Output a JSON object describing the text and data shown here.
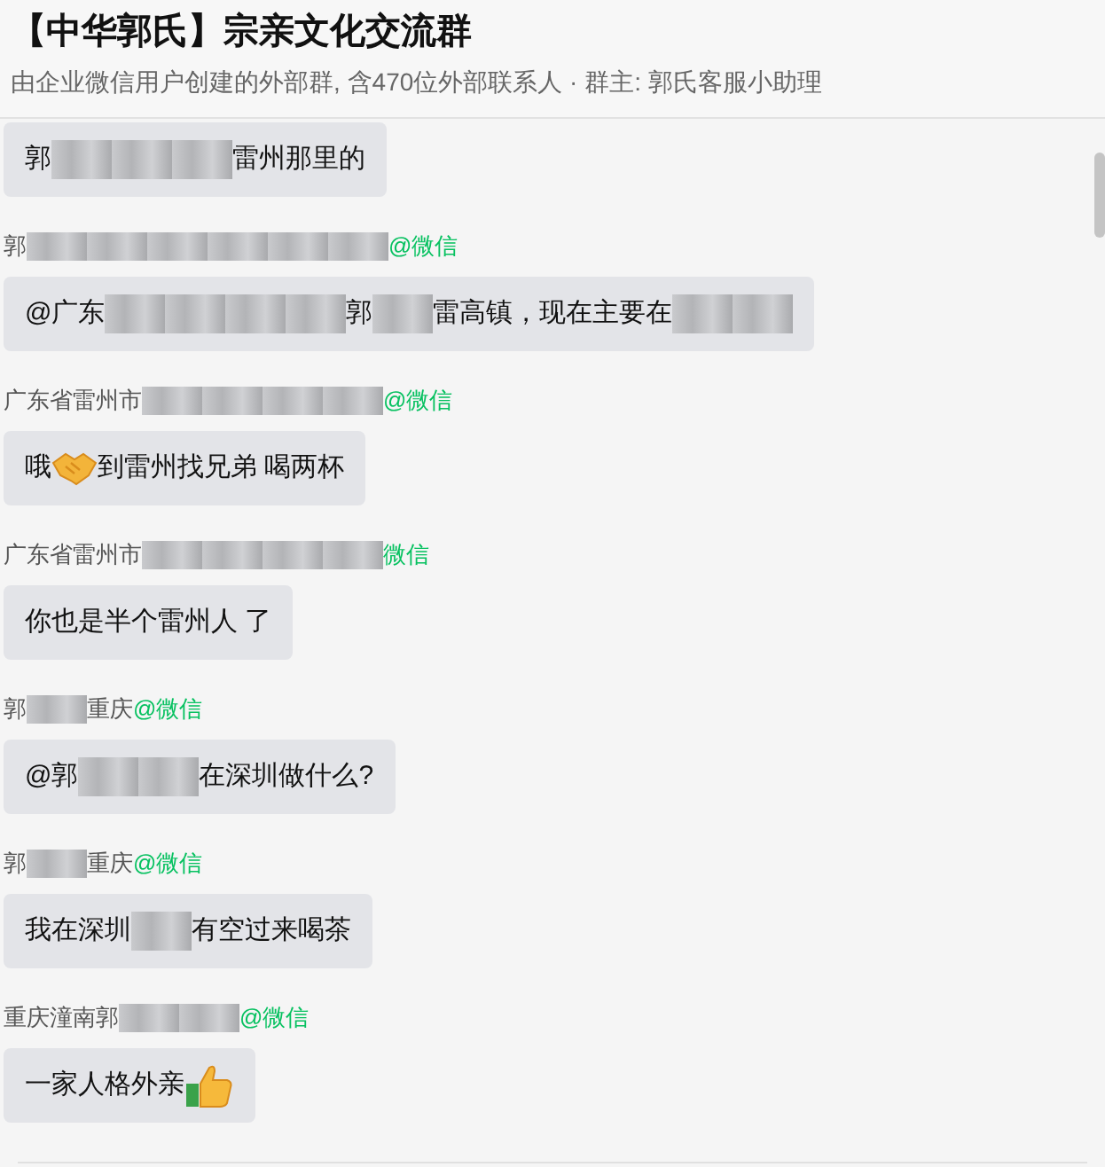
{
  "header": {
    "title": "【中华郭氏】宗亲文化交流群",
    "subtitle": "由企业微信用户创建的外部群, 含470位外部联系人 · 群主: 郭氏客服小助理"
  },
  "messages": [
    {
      "content": [
        {
          "kind": "text",
          "text": "郭"
        },
        {
          "kind": "redacted"
        },
        {
          "kind": "redacted"
        },
        {
          "kind": "redacted"
        },
        {
          "kind": "text",
          "text": "雷州那里的"
        }
      ]
    },
    {
      "sender": {
        "parts": [
          {
            "kind": "text",
            "text": "郭"
          },
          {
            "kind": "redacted"
          },
          {
            "kind": "redacted"
          },
          {
            "kind": "redacted"
          },
          {
            "kind": "redacted"
          },
          {
            "kind": "redacted"
          },
          {
            "kind": "redacted"
          }
        ],
        "suffix": "@微信"
      },
      "content": [
        {
          "kind": "text",
          "text": "@广东"
        },
        {
          "kind": "redacted"
        },
        {
          "kind": "redacted"
        },
        {
          "kind": "redacted"
        },
        {
          "kind": "redacted"
        },
        {
          "kind": "text",
          "text": "郭"
        },
        {
          "kind": "redacted"
        },
        {
          "kind": "text",
          "text": "雷高镇，现在主要在"
        },
        {
          "kind": "redacted"
        },
        {
          "kind": "redacted"
        }
      ]
    },
    {
      "sender": {
        "parts": [
          {
            "kind": "text",
            "text": "广东省雷州市"
          },
          {
            "kind": "redacted"
          },
          {
            "kind": "redacted"
          },
          {
            "kind": "redacted"
          },
          {
            "kind": "redacted"
          }
        ],
        "suffix": "@微信"
      },
      "content": [
        {
          "kind": "text",
          "text": "哦"
        },
        {
          "kind": "handshake"
        },
        {
          "kind": "text",
          "text": "到雷州找兄弟 喝两杯"
        }
      ]
    },
    {
      "sender": {
        "parts": [
          {
            "kind": "text",
            "text": "广东省雷州市"
          },
          {
            "kind": "redacted"
          },
          {
            "kind": "redacted"
          },
          {
            "kind": "redacted"
          },
          {
            "kind": "redacted"
          }
        ],
        "suffix": "微信"
      },
      "content": [
        {
          "kind": "text",
          "text": "你也是半个雷州人 了"
        }
      ]
    },
    {
      "sender": {
        "parts": [
          {
            "kind": "text",
            "text": "郭"
          },
          {
            "kind": "redacted"
          },
          {
            "kind": "text",
            "text": "重庆"
          }
        ],
        "suffix": "@微信"
      },
      "content": [
        {
          "kind": "text",
          "text": "@郭"
        },
        {
          "kind": "redacted"
        },
        {
          "kind": "redacted"
        },
        {
          "kind": "text",
          "text": "在深圳做什么?"
        }
      ]
    },
    {
      "sender": {
        "parts": [
          {
            "kind": "text",
            "text": "郭"
          },
          {
            "kind": "redacted"
          },
          {
            "kind": "text",
            "text": "重庆"
          }
        ],
        "suffix": "@微信"
      },
      "content": [
        {
          "kind": "text",
          "text": "我在深圳"
        },
        {
          "kind": "redacted"
        },
        {
          "kind": "text",
          "text": "有空过来喝茶"
        }
      ]
    },
    {
      "sender": {
        "parts": [
          {
            "kind": "text",
            "text": "重庆潼南郭"
          },
          {
            "kind": "redacted"
          },
          {
            "kind": "redacted"
          }
        ],
        "suffix": "@微信"
      },
      "content": [
        {
          "kind": "text",
          "text": "一家人格外亲"
        },
        {
          "kind": "thumbsup"
        }
      ]
    }
  ]
}
